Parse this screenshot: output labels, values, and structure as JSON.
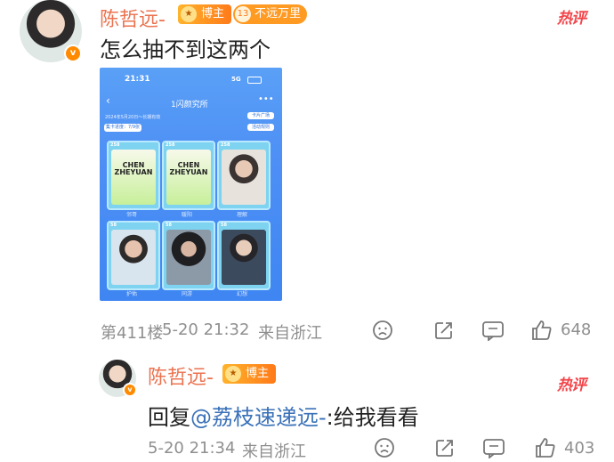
{
  "colors": {
    "username": "#eb7350",
    "hot": "#f2454a",
    "mention": "#3a71b8",
    "meta": "#8f8f8f"
  },
  "main_comment": {
    "username": "陈哲远-",
    "badge_blogger": "博主",
    "level_badge_num": "13",
    "level_badge_text": "不远万里",
    "hot_label": "热评",
    "text": "怎么抽不到这两个",
    "floor": "第411楼",
    "time": "5-20 21:32",
    "location": "来自浙江",
    "like_count": "648",
    "icons": [
      "avatar",
      "verified-icon",
      "emoji-icon",
      "share-icon",
      "comment-icon",
      "like-icon"
    ]
  },
  "screenshot": {
    "time": "21:31",
    "signal": "5G",
    "title": "1闪颜究所",
    "subtitle": "2024年5月20日～长期有效",
    "progress_label": "集卡进度：7/9张",
    "chip_square": "卡片广场",
    "chip_rules": "活动规则",
    "cards": [
      {
        "num": "258",
        "logo": "CHEN ZHEYUAN",
        "label": "邻哥"
      },
      {
        "num": "258",
        "logo": "CHEN ZHEYUAN",
        "label": "暖阳"
      },
      {
        "num": "258",
        "logo": "",
        "label": "理解"
      },
      {
        "num": "58",
        "logo": "",
        "label": "护佑"
      },
      {
        "num": "58",
        "logo": "",
        "label": "同游"
      },
      {
        "num": "58",
        "logo": "",
        "label": "幻想"
      }
    ]
  },
  "reply": {
    "username": "陈哲远-",
    "badge_blogger": "博主",
    "hot_label": "热评",
    "prefix": "回复",
    "mention": "@荔枝速递远-",
    "text": ":给我看看",
    "time": "5-20 21:34",
    "location": "来自浙江",
    "like_count": "403"
  }
}
